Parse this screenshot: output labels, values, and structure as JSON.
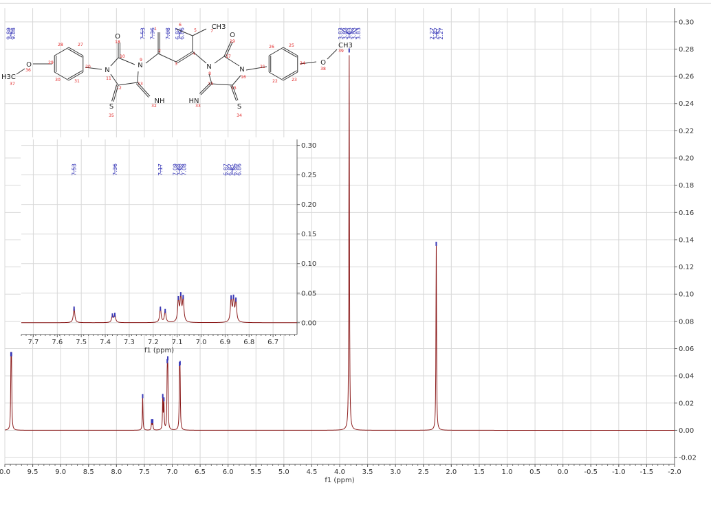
{
  "colors": {
    "trace": "#8b1a1a",
    "peak_marker": "#3a3ab8",
    "grid": "#d8d8d8",
    "axis": "#606060"
  },
  "chart_data": [
    {
      "name": "main-spectrum",
      "type": "line",
      "xlabel": "f1 (ppm)",
      "ylabel": "",
      "xlim": [
        10.0,
        -2.0
      ],
      "ylim": [
        -0.025,
        0.31
      ],
      "x_reversed": true,
      "x_ticks": [
        "0.0",
        "9.5",
        "9.0",
        "8.5",
        "8.0",
        "7.5",
        "7.0",
        "6.5",
        "6.0",
        "5.5",
        "5.0",
        "4.5",
        "4.0",
        "3.5",
        "3.0",
        "2.5",
        "2.0",
        "1.5",
        "1.0",
        "0.5",
        "0.0",
        "-0.5",
        "-1.0",
        "-1.5",
        "-2.0"
      ],
      "x_tick_values": [
        10.0,
        9.5,
        9.0,
        8.5,
        8.0,
        7.5,
        7.0,
        6.5,
        6.0,
        5.5,
        5.0,
        4.5,
        4.0,
        3.5,
        3.0,
        2.5,
        2.0,
        1.5,
        1.0,
        0.5,
        0.0,
        -0.5,
        -1.0,
        -1.5,
        -2.0
      ],
      "y_ticks": [
        "0.30",
        "0.28",
        "0.26",
        "0.24",
        "0.22",
        "0.20",
        "0.18",
        "0.16",
        "0.14",
        "0.12",
        "0.10",
        "0.08",
        "0.06",
        "0.04",
        "0.02",
        "0.00",
        "-0.02"
      ],
      "y_tick_values": [
        0.3,
        0.28,
        0.26,
        0.24,
        0.22,
        0.2,
        0.18,
        0.16,
        0.14,
        0.12,
        0.1,
        0.08,
        0.06,
        0.04,
        0.02,
        0.0,
        -0.02
      ],
      "grid": true,
      "peaks": [
        {
          "ppm": 9.89,
          "height": 0.045
        },
        {
          "ppm": 9.88,
          "height": 0.045
        },
        {
          "ppm": 7.53,
          "height": 0.026
        },
        {
          "ppm": 7.37,
          "height": 0.007
        },
        {
          "ppm": 7.35,
          "height": 0.007
        },
        {
          "ppm": 7.17,
          "height": 0.024
        },
        {
          "ppm": 7.15,
          "height": 0.021
        },
        {
          "ppm": 7.09,
          "height": 0.04
        },
        {
          "ppm": 7.08,
          "height": 0.043
        },
        {
          "ppm": 6.87,
          "height": 0.039
        },
        {
          "ppm": 6.86,
          "height": 0.04
        },
        {
          "ppm": 3.83,
          "height": 0.28
        },
        {
          "ppm": 2.27,
          "height": 0.138
        }
      ],
      "peak_labels": [
        {
          "ppm": 9.89,
          "label": "9.89"
        },
        {
          "ppm": 9.88,
          "label": "9.88"
        },
        {
          "ppm": 7.53,
          "label": "7.53"
        },
        {
          "ppm": 7.36,
          "label": "7.36"
        },
        {
          "ppm": 7.08,
          "label": "7.08"
        },
        {
          "ppm": 6.87,
          "label": "6.87"
        },
        {
          "ppm": 6.86,
          "label": "6.86"
        },
        {
          "ppm": 3.83,
          "label": "3.83"
        },
        {
          "ppm": 3.83,
          "label": "3.83"
        },
        {
          "ppm": 3.83,
          "label": "3.83"
        },
        {
          "ppm": 3.83,
          "label": "3.83"
        },
        {
          "ppm": 3.83,
          "label": "3.83"
        },
        {
          "ppm": 2.27,
          "label": "2.27"
        },
        {
          "ppm": 2.27,
          "label": "2.27"
        },
        {
          "ppm": 2.27,
          "label": "2.27"
        }
      ]
    },
    {
      "name": "inset-spectrum",
      "type": "line",
      "xlabel": "f1 (ppm)",
      "ylabel": "",
      "xlim": [
        7.75,
        6.6
      ],
      "ylim": [
        -0.02,
        0.31
      ],
      "x_reversed": true,
      "x_ticks": [
        "7.7",
        "7.6",
        "7.5",
        "7.4",
        "7.3",
        "7.2",
        "7.1",
        "7.0",
        "6.9",
        "6.8",
        "6.7"
      ],
      "x_tick_values": [
        7.7,
        7.6,
        7.5,
        7.4,
        7.3,
        7.2,
        7.1,
        7.0,
        6.9,
        6.8,
        6.7
      ],
      "y_ticks": [
        "0.30",
        "0.25",
        "0.20",
        "0.15",
        "0.10",
        "0.05",
        "0.00"
      ],
      "y_tick_values": [
        0.3,
        0.25,
        0.2,
        0.15,
        0.1,
        0.05,
        0.0
      ],
      "grid": true,
      "peaks": [
        {
          "ppm": 7.53,
          "height": 0.026
        },
        {
          "ppm": 7.37,
          "height": 0.013
        },
        {
          "ppm": 7.36,
          "height": 0.014
        },
        {
          "ppm": 7.17,
          "height": 0.025
        },
        {
          "ppm": 7.15,
          "height": 0.021
        },
        {
          "ppm": 7.095,
          "height": 0.038
        },
        {
          "ppm": 7.085,
          "height": 0.042
        },
        {
          "ppm": 7.075,
          "height": 0.04
        },
        {
          "ppm": 6.875,
          "height": 0.04
        },
        {
          "ppm": 6.865,
          "height": 0.038
        },
        {
          "ppm": 6.855,
          "height": 0.036
        }
      ],
      "peak_labels": [
        {
          "ppm": 7.53,
          "label": "7.53"
        },
        {
          "ppm": 7.36,
          "label": "7.36"
        },
        {
          "ppm": 7.17,
          "label": "7.17"
        },
        {
          "ppm": 7.09,
          "label": "7.09"
        },
        {
          "ppm": 7.08,
          "label": "7.08"
        },
        {
          "ppm": 7.08,
          "label": "7.08"
        },
        {
          "ppm": 6.87,
          "label": "6.87"
        },
        {
          "ppm": 6.87,
          "label": "6.87"
        },
        {
          "ppm": 6.86,
          "label": "6.86"
        },
        {
          "ppm": 6.86,
          "label": "6.86"
        }
      ]
    }
  ],
  "structure": {
    "atoms": [
      {
        "text": "O",
        "id": "o-18"
      },
      {
        "text": "O",
        "id": "o-19"
      },
      {
        "text": "N",
        "id": "n-11"
      },
      {
        "text": "N",
        "id": "n-9"
      },
      {
        "text": "N",
        "id": "n-8"
      },
      {
        "text": "N",
        "id": "n-16"
      },
      {
        "text": "O",
        "id": "o-36"
      },
      {
        "text": "O",
        "id": "o-38"
      },
      {
        "text": "H3C",
        "id": "h3c-37"
      },
      {
        "text": "CH3",
        "id": "ch3-39"
      },
      {
        "text": "CH3",
        "id": "ch3-7"
      },
      {
        "text": "S",
        "id": "s-35"
      },
      {
        "text": "S",
        "id": "s-34"
      },
      {
        "text": "NH",
        "id": "nh-32"
      },
      {
        "text": "HN",
        "id": "hn-33"
      }
    ],
    "indices": [
      "1",
      "2",
      "3",
      "4",
      "5",
      "6",
      "7",
      "8",
      "9",
      "10",
      "11",
      "12",
      "13",
      "14",
      "15",
      "16",
      "17",
      "18",
      "19",
      "20",
      "21",
      "22",
      "23",
      "24",
      "25",
      "26",
      "27",
      "28",
      "29",
      "30",
      "31",
      "32",
      "33",
      "34",
      "35",
      "36",
      "37",
      "38",
      "39"
    ]
  }
}
